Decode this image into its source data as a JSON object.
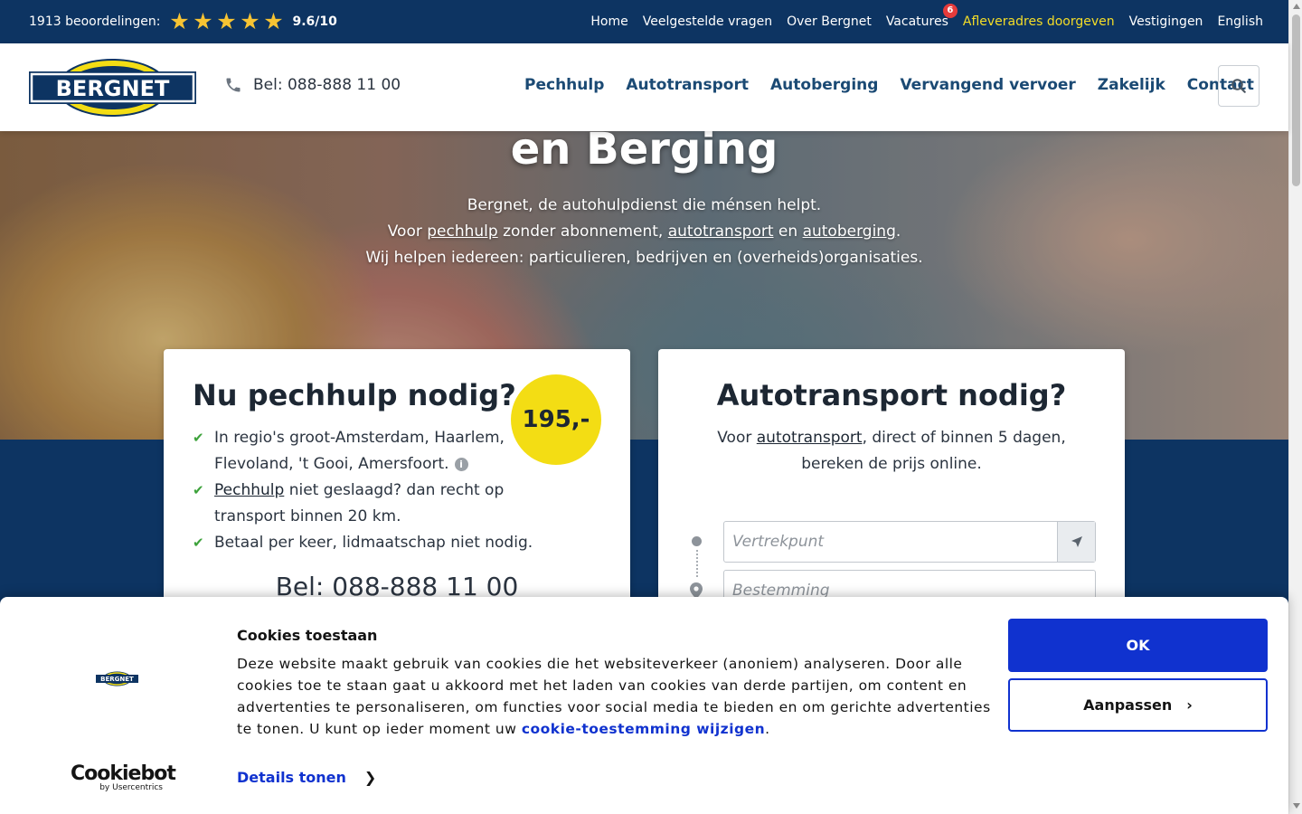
{
  "topbar": {
    "reviews_label": "1913 beoordelingen:",
    "stars": 5,
    "score": "9.6/10",
    "links": [
      {
        "label": "Home"
      },
      {
        "label": "Veelgestelde vragen"
      },
      {
        "label": "Over Bergnet"
      },
      {
        "label": "Vacatures",
        "badge": "6"
      },
      {
        "label": "Afleveradres doorgeven",
        "highlight": true
      },
      {
        "label": "Vestigingen"
      },
      {
        "label": "English"
      }
    ]
  },
  "header": {
    "logo_text": "BERGNET",
    "phone": "Bel: 088-888 11 00",
    "nav": [
      "Pechhulp",
      "Autotransport",
      "Autoberging",
      "Vervangend vervoer",
      "Zakelijk",
      "Contact"
    ]
  },
  "hero": {
    "title": "en Berging",
    "line1": "Bergnet, de autohulpdienst die ménsen helpt.",
    "line2_pre": "Voor ",
    "line2_link1": "pechhulp",
    "line2_mid1": " zonder abonnement, ",
    "line2_link2": "autotransport",
    "line2_mid2": " en ",
    "line2_link3": "autoberging",
    "line2_post": ".",
    "line3": "Wij helpen iedereen: particulieren, bedrijven en (overheids)organisaties."
  },
  "pechhulp_card": {
    "title": "Nu pechhulp nodig?",
    "price": "195,-",
    "item1": "In regio's groot-Amsterdam, Haarlem, Flevoland, 't Gooi, Amersfoort.",
    "item2_link": "Pechhulp",
    "item2_rest": " niet geslaagd? dan recht op transport binnen 20 km.",
    "item3": "Betaal per keer, lidmaatschap niet nodig.",
    "phone": "Bel: 088-888 11 00"
  },
  "transport_card": {
    "title": "Autotransport nodig?",
    "desc_pre": "Voor ",
    "desc_link": "autotransport",
    "desc_post": ", direct of binnen 5 dagen, bereken de prijs online.",
    "from_placeholder": "Vertrekpunt",
    "to_placeholder": "Bestemming"
  },
  "cookie": {
    "logo_text": "BERGNET",
    "title": "Cookies toestaan",
    "text": "Deze website maakt gebruik van cookies die het websiteverkeer (anoniem) analyseren. Door alle cookies toe te staan gaat u akkoord met het laden van cookies van derde partijen, om content en advertenties te personaliseren, om functies voor social media te bieden en om gerichte advertenties te tonen. U kunt op ieder moment uw ",
    "link": "cookie-toestemming wijzigen",
    "text_end": ".",
    "details": "Details tonen",
    "ok": "OK",
    "customize": "Aanpassen",
    "brand": "Cookiebot",
    "brand_sub": "by Usercentrics"
  },
  "colors": {
    "navy": "#0d3462",
    "nav_text": "#1b4a74",
    "yellow": "#f3dd14",
    "highlight_link": "#f4dd27",
    "cookie_blue": "#1032cf",
    "check_green": "#3da23b"
  }
}
